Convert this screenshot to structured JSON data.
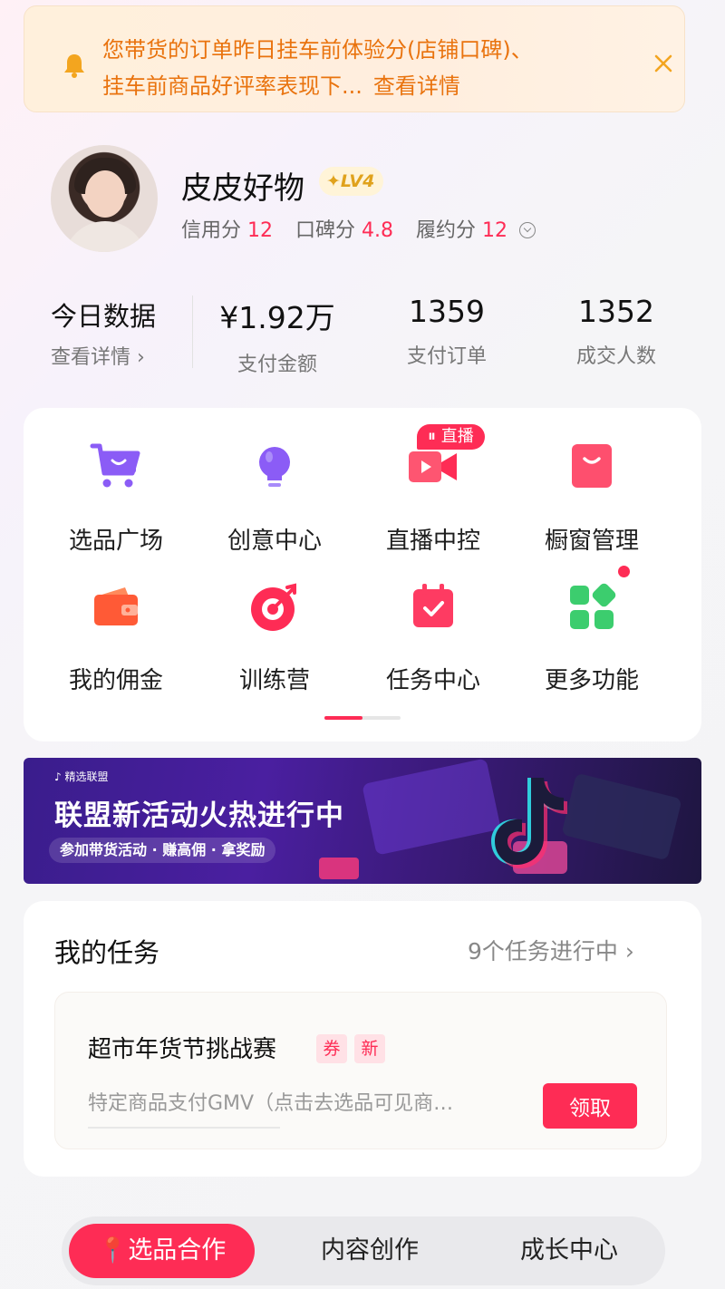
{
  "notice": {
    "line1": "您带货的订单昨日挂车前体验分(店铺口碑)、",
    "line2": "挂车前商品好评率表现下...",
    "link": "查看详情"
  },
  "profile": {
    "name": "皮皮好物",
    "level": "LV4",
    "credit_label": "信用分",
    "credit_value": "12",
    "reputation_label": "口碑分",
    "reputation_value": "4.8",
    "fulfillment_label": "履约分",
    "fulfillment_value": "12"
  },
  "today": {
    "title": "今日数据",
    "link": "查看详情 ›",
    "stats": [
      {
        "value": "¥1.92万",
        "label": "支付金额"
      },
      {
        "value": "1359",
        "label": "支付订单"
      },
      {
        "value": "1352",
        "label": "成交人数"
      }
    ]
  },
  "grid": {
    "items": [
      {
        "label": "选品广场",
        "icon": "cart-icon"
      },
      {
        "label": "创意中心",
        "icon": "lightbulb-icon"
      },
      {
        "label": "直播中控",
        "icon": "video-camera-icon"
      },
      {
        "label": "橱窗管理",
        "icon": "shopping-bag-icon"
      },
      {
        "label": "我的佣金",
        "icon": "wallet-icon"
      },
      {
        "label": "训练营",
        "icon": "target-icon"
      },
      {
        "label": "任务中心",
        "icon": "calendar-check-icon"
      },
      {
        "label": "更多功能",
        "icon": "apps-grid-icon"
      }
    ],
    "live_tag": "直播"
  },
  "banner": {
    "brand": "精选联盟",
    "headline": "联盟新活动火热进行中",
    "subline": "参加带货活动 · 赚高佣 · 拿奖励"
  },
  "tasks": {
    "title": "我的任务",
    "more": "9个任务进行中 ›",
    "item": {
      "name": "超市年货节挑战赛",
      "tag1": "券",
      "tag2": "新",
      "desc": "特定商品支付GMV（点击去选品可见商…",
      "button": "领取"
    }
  },
  "bottom_nav": {
    "items": [
      "选品合作",
      "内容创作",
      "成长中心"
    ]
  },
  "colors": {
    "accent": "#fe2c55",
    "notice_text": "#e9730e",
    "purple": "#8b5cf6",
    "green": "#3ccd6e"
  }
}
